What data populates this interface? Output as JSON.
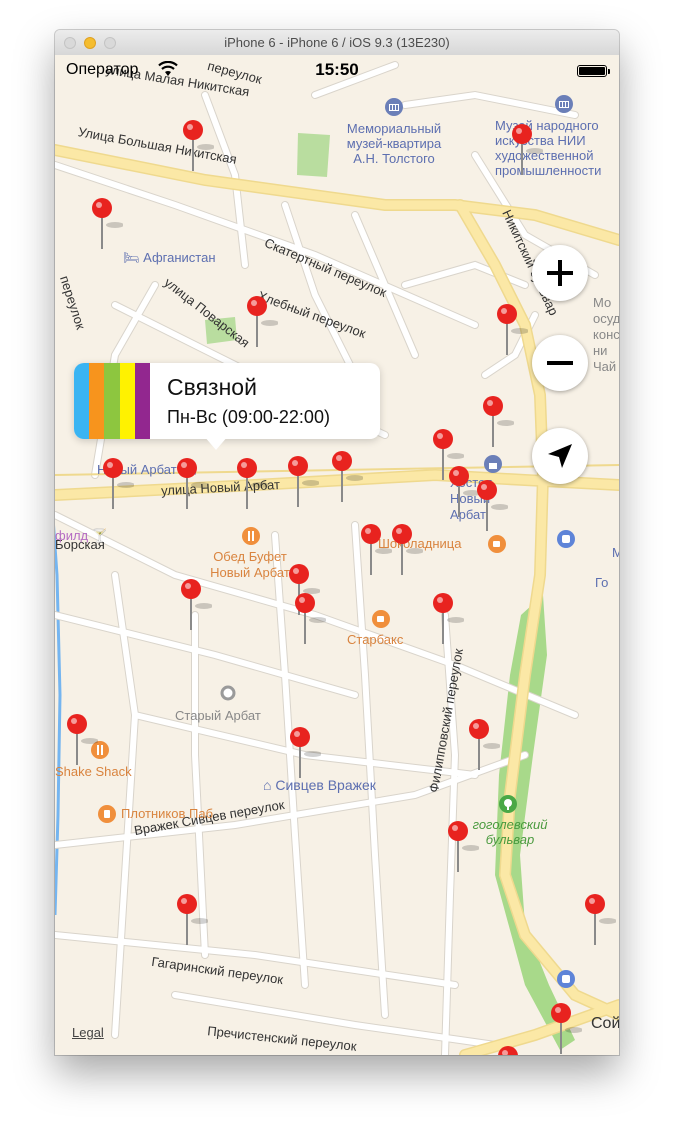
{
  "window": {
    "title": "iPhone 6 - iPhone 6 / iOS 9.3 (13E230)"
  },
  "status_bar": {
    "carrier": "Оператор",
    "time": "15:50"
  },
  "map": {
    "streets": [
      "улица Малая Никитская",
      "Улица Большая Никитская",
      "Скатертный переулок",
      "Хлебный переулок",
      "улица Поварская",
      "Никитский бульвар",
      "улица Новый Арбат",
      "Вражек Сивцев переулок",
      "Филипповский переулок",
      "Гагаринский переулок",
      "Пречистенский переулок",
      "переулок",
      "переулок",
      "Борская"
    ],
    "pois": {
      "museum_tolstoy": "Мемориальный музей-квартира А.Н. Толстого",
      "museum_folk": "Музей народного искусства НИИ художественной промышленности",
      "afghanistan": "Афганистан",
      "hostel": "Хостел Новый Арбат",
      "novy_arbat_partial": "Новый Арбат",
      "obed_bufet": "Обед Буфет Новый Арбат",
      "shokoladnitsa": "Шоколадница",
      "starbucks": "Старбакс",
      "stary_arbat": "Старый Арбат",
      "shake_shack": "Shake Shack",
      "sivtsev": "Сивцев Вражек",
      "plotnikov": "Плотников Паб",
      "gogol": "гоголевский бульвар",
      "filid": "филд",
      "moscow_partial": "Мо осуд конс ни Чай",
      "edge_m": "М",
      "edge_go": "Го",
      "edge_soi": "Сой"
    }
  },
  "callout": {
    "name": "Связной",
    "hours": "Пн-Вс (09:00-22:00)",
    "logo_colors": [
      "#3ab4f2",
      "#f7941d",
      "#8dc63f",
      "#fff200",
      "#92278f"
    ]
  },
  "controls": {
    "zoom_in": "plus-icon",
    "zoom_out": "minus-icon",
    "locate": "location-arrow-icon"
  },
  "legal": "Legal",
  "colors": {
    "pin": "#e8231f",
    "road": "#fbe8a6",
    "water": "#75b5f0",
    "park": "#a8d98a"
  }
}
